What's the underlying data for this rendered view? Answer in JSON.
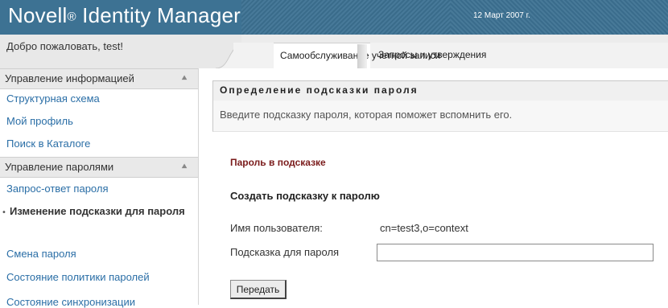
{
  "header": {
    "brand": "Novell",
    "reg": "®",
    "product": "Identity Manager",
    "date": "12 Март 2007 г."
  },
  "welcome": "Добро пожаловать, test!",
  "tabs": [
    {
      "label": "Самообслуживание учетной записи",
      "active": true
    },
    {
      "label": "Запросы и утверждения",
      "active": false
    }
  ],
  "sidebar": {
    "sections": [
      {
        "title": "Управление информацией",
        "items": [
          "Структурная схема",
          "Мой профиль",
          "Поиск в Каталоге"
        ]
      },
      {
        "title": "Управление паролями",
        "items": [
          "Запрос-ответ пароля",
          "Изменение подсказки для пароля",
          "Смена пароля",
          "Состояние политики паролей",
          "Состояние синхронизации"
        ]
      }
    ],
    "current_item": "Изменение подсказки для пароля",
    "collapse_icon": "double-chevron-up-icon"
  },
  "main": {
    "title": "Определение подсказки пароля",
    "description": "Введите подсказку пароля, которая поможет вспомнить его.",
    "hint_label": "Пароль в подсказке",
    "section_title": "Создать подсказку к паролю",
    "username_label": "Имя пользователя:",
    "username_value": "cn=test3,o=context",
    "hint_field_label": "Подсказка для пароля",
    "hint_field_value": "",
    "submit_label": "Передать"
  },
  "colors": {
    "banner": "#3d7293",
    "link": "#2a6ea6",
    "hint_label": "#7a1b1b"
  }
}
